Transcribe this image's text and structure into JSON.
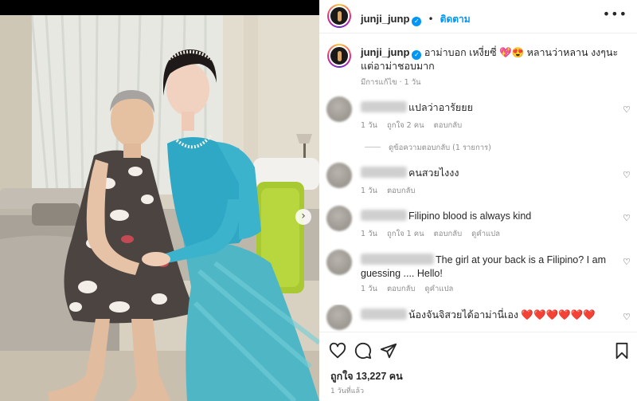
{
  "post": {
    "username": "junji_junp",
    "follow_label": "ติดตาม",
    "caption": "อาม่าบอก เหงี่ยซี่ 💖😍 หลานว่าหลาน งงๆนะ แต่อาม่าชอบมาก",
    "caption_meta": "มีการแก้ไข · 1 วัน"
  },
  "comments": [
    {
      "text": "แปลว่าอารัยยย",
      "time": "1 วัน",
      "likes": "ถูกใจ 2 คน",
      "reply": "ตอบกลับ"
    },
    {
      "text": "คนสวยไงงง",
      "time": "1 วัน",
      "reply": "ตอบกลับ"
    },
    {
      "text": "Filipino blood is always kind",
      "time": "1 วัน",
      "likes": "ถูกใจ 1 คน",
      "reply": "ตอบกลับ",
      "translate": "ดูคำแปล"
    },
    {
      "text": "The girl at your back is a Filipino? I am guessing .... Hello!",
      "time": "1 วัน",
      "reply": "ตอบกลับ",
      "translate": "ดูคำแปล"
    },
    {
      "text": "น้องจันจิสวยได้อาม่านี่เอง ❤️❤️❤️❤️❤️❤️"
    }
  ],
  "replies_label": "ดูข้อความตอบกลับ (1 รายการ)",
  "footer": {
    "likes": "ถูกใจ 13,227 คน",
    "time_ago": "1 วันที่แล้ว"
  },
  "colors": {
    "accent": "#0095f6",
    "heart_red": "#ed4956"
  },
  "icons": [
    "verified-badge-icon",
    "more-options-icon",
    "heart-icon",
    "comment-icon",
    "share-icon",
    "bookmark-icon",
    "chevron-right-icon"
  ]
}
